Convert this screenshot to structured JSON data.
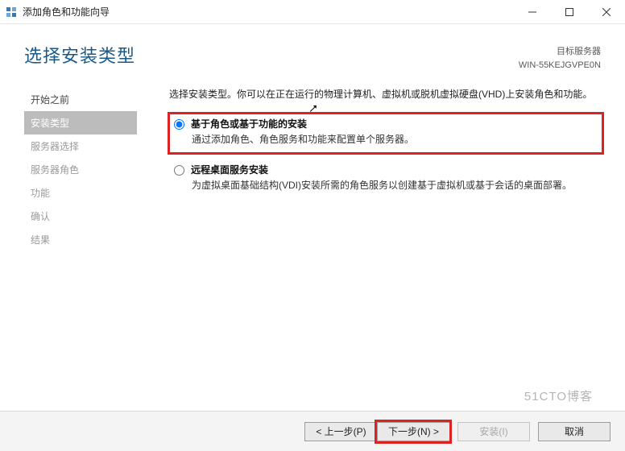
{
  "window": {
    "title": "添加角色和功能向导"
  },
  "header": {
    "page_title": "选择安装类型",
    "server_label": "目标服务器",
    "server_name": "WIN-55KEJGVPE0N"
  },
  "sidebar": {
    "steps": [
      {
        "label": "开始之前",
        "state": "done"
      },
      {
        "label": "安装类型",
        "state": "active"
      },
      {
        "label": "服务器选择",
        "state": "pending"
      },
      {
        "label": "服务器角色",
        "state": "pending"
      },
      {
        "label": "功能",
        "state": "pending"
      },
      {
        "label": "确认",
        "state": "pending"
      },
      {
        "label": "结果",
        "state": "pending"
      }
    ]
  },
  "content": {
    "intro": "选择安装类型。你可以在正在运行的物理计算机、虚拟机或脱机虚拟硬盘(VHD)上安装角色和功能。",
    "options": [
      {
        "id": "role-based",
        "title": "基于角色或基于功能的安装",
        "desc": "通过添加角色、角色服务和功能来配置单个服务器。",
        "selected": true,
        "highlight": true
      },
      {
        "id": "rds",
        "title": "远程桌面服务安装",
        "desc": "为虚拟桌面基础结构(VDI)安装所需的角色服务以创建基于虚拟机或基于会话的桌面部署。",
        "selected": false,
        "highlight": false
      }
    ]
  },
  "footer": {
    "prev": "< 上一步(P)",
    "next": "下一步(N) >",
    "install": "安装(I)",
    "cancel": "取消"
  },
  "watermark": "51CTO博客"
}
